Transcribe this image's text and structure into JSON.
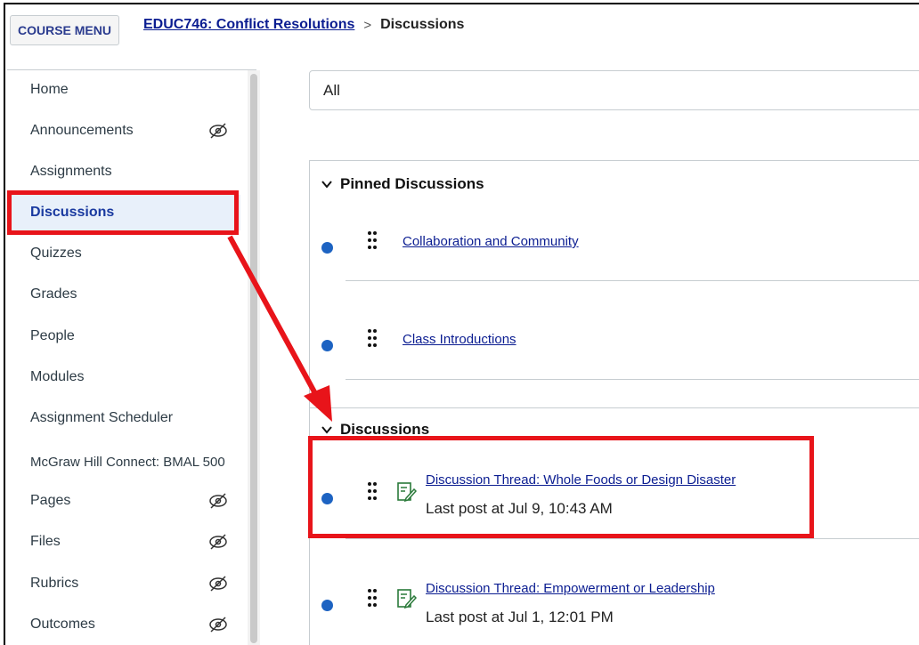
{
  "topbar": {
    "course_menu_label": "COURSE MENU",
    "breadcrumb_course": "EDUC746: Conflict Resolutions",
    "breadcrumb_sep": ">",
    "breadcrumb_current": "Discussions"
  },
  "sidebar": {
    "items": [
      {
        "label": "Home",
        "hidden": false
      },
      {
        "label": "Announcements",
        "hidden": true
      },
      {
        "label": "Assignments",
        "hidden": false
      },
      {
        "label": "Discussions",
        "hidden": false,
        "active": true
      },
      {
        "label": "Quizzes",
        "hidden": false
      },
      {
        "label": "Grades",
        "hidden": false
      },
      {
        "label": "People",
        "hidden": false
      },
      {
        "label": "Modules",
        "hidden": false
      },
      {
        "label": "Assignment Scheduler",
        "hidden": false
      },
      {
        "label": "McGraw Hill Connect: BMAL 500",
        "hidden": false
      },
      {
        "label": "Pages",
        "hidden": true
      },
      {
        "label": "Files",
        "hidden": true
      },
      {
        "label": "Rubrics",
        "hidden": true
      },
      {
        "label": "Outcomes",
        "hidden": true
      }
    ]
  },
  "filter": {
    "value": "All"
  },
  "pinned": {
    "header": "Pinned Discussions",
    "items": [
      {
        "title": "Collaboration and Community"
      },
      {
        "title": "Class Introductions"
      }
    ]
  },
  "discussions": {
    "header": "Discussions",
    "items": [
      {
        "title": "Discussion Thread: Whole Foods or Design Disaster",
        "last_post": "Last post at Jul 9, 10:43 AM"
      },
      {
        "title": "Discussion Thread: Empowerment or Leadership",
        "last_post": "Last post at Jul 1, 12:01 PM"
      }
    ]
  },
  "colors": {
    "accent": "#0b1d91",
    "unread_dot": "#1d63c2",
    "annotation": "#e8141a",
    "active_bg": "#e8f0fa"
  }
}
